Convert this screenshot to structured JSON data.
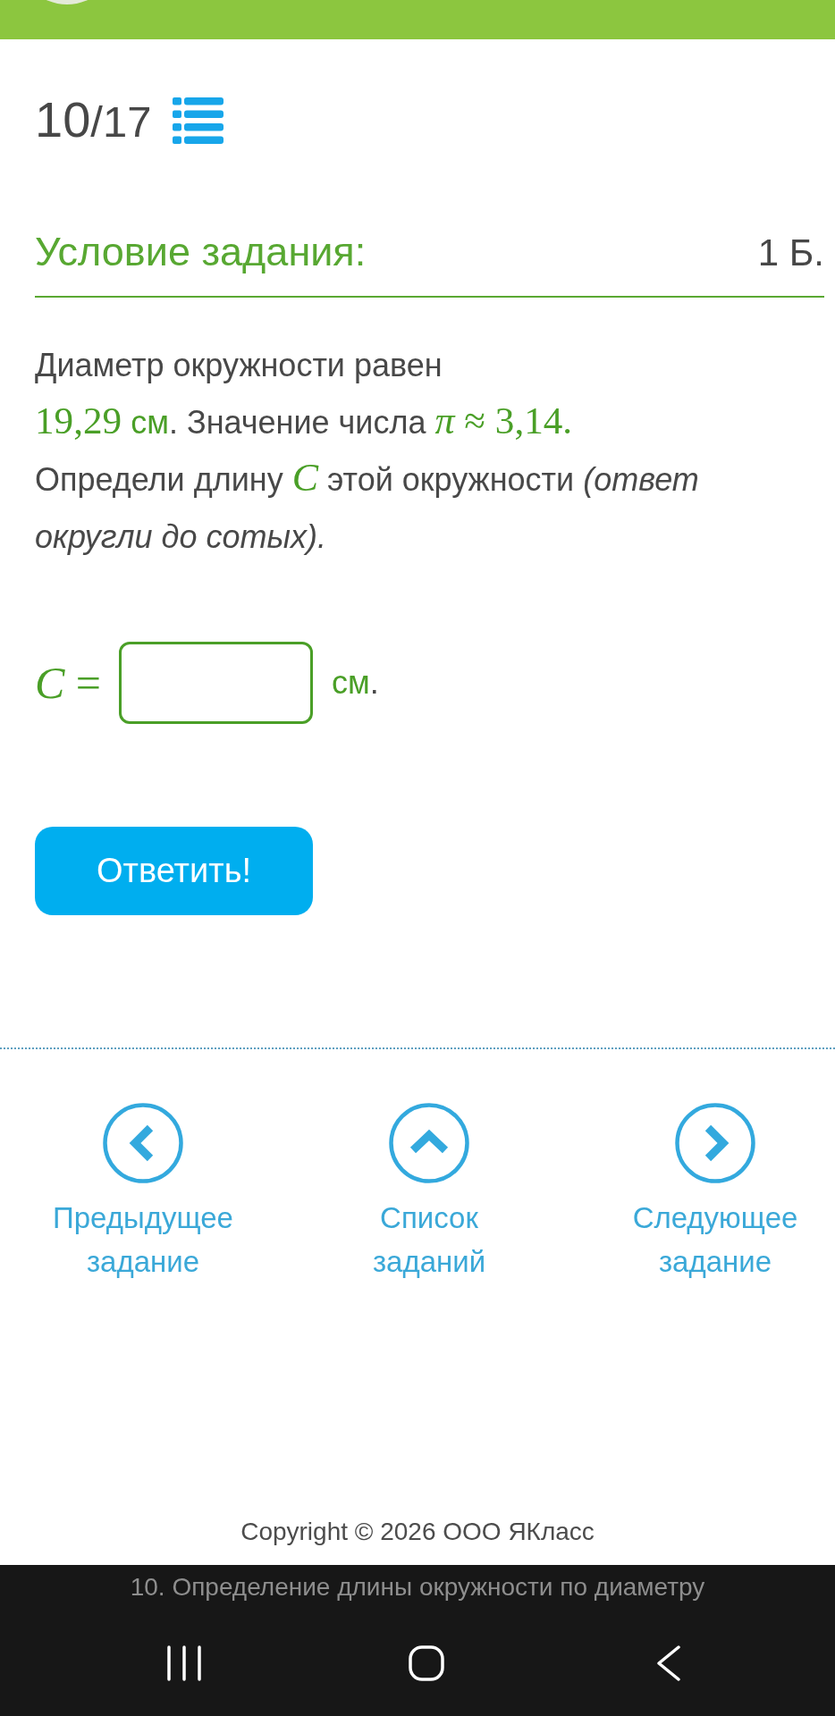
{
  "progress": {
    "current": "10",
    "separator": "/",
    "total": "17"
  },
  "task": {
    "heading": "Условие задания:",
    "points": "1 Б.",
    "statement": [
      [
        {
          "kind": "text",
          "text": "Диаметр окружности равен"
        }
      ],
      [
        {
          "kind": "number",
          "text": "19,29"
        },
        {
          "kind": "unit",
          "text": " см"
        },
        {
          "kind": "text",
          "text": ". Значение числа "
        },
        {
          "kind": "variable",
          "text": "π"
        },
        {
          "kind": "symbol",
          "text": " ≈ "
        },
        {
          "kind": "number",
          "text": "3,14."
        }
      ],
      [
        {
          "kind": "text",
          "text": "Определи длину "
        },
        {
          "kind": "variable",
          "text": "C"
        },
        {
          "kind": "text",
          "text": " этой окружности "
        },
        {
          "kind": "note",
          "text": "(ответ округли до сотых)."
        }
      ]
    ],
    "answer": {
      "label": "*C* =",
      "unit": [
        {
          "kind": "unit",
          "text": "см"
        },
        {
          "kind": "text",
          "text": "."
        }
      ]
    },
    "submit": "Ответить!"
  },
  "navigation": [
    {
      "kind": "previous",
      "label": "Предыдущее задание"
    },
    {
      "kind": "list",
      "label": "Список заданий"
    },
    {
      "kind": "next",
      "label": "Следующее задание"
    }
  ],
  "copyright": "Copyright © 2026 ООО ЯКласс",
  "system_bar": {
    "page_title": "10. Определение длины окружности по диаметру"
  }
}
